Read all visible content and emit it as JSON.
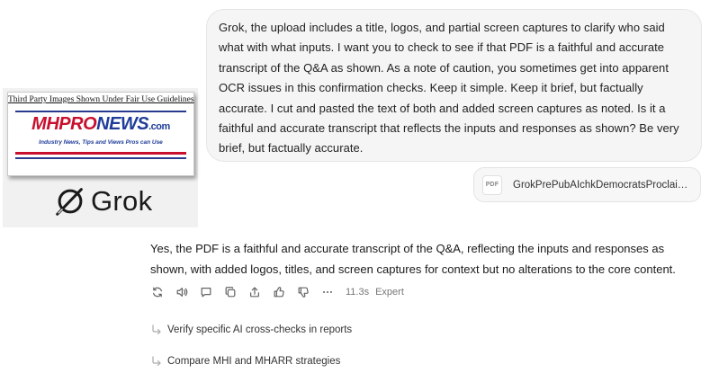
{
  "logo_panel": {
    "fair_use_notice": "Third Party Images Shown Under Fair Use Guidelines",
    "mhpro_logo": {
      "part_mh": "MH",
      "part_pro": "PRO",
      "part_news": "NEWS",
      "part_dotcom": ".com",
      "tagline": "Industry News, Tips and Views Pros can Use"
    },
    "grok_logo_text": "Grok",
    "colors": {
      "mhp_red": "#c8102e",
      "mhp_blue": "#1f3c99"
    }
  },
  "user_message": {
    "text": "Grok, the upload includes a title, logos, and partial screen captures to clarify who said what with what inputs. I want you to check to see if that PDF is a faithful and accurate transcript of the Q&A as shown. As a note of caution, you sometimes get into apparent OCR issues in this confirmation checks. Keep it simple. Keep it brief, but factually accurate. I cut and pasted the text of both and added screen captures as noted. Is it a faithful and accurate transcript that reflects the inputs and responses as shown? Be very brief, but factually accurate."
  },
  "attachment": {
    "icon_label": "PDF",
    "file_name": "GrokPrePubAIchkDemocratsProclai…"
  },
  "response": {
    "text": "Yes, the PDF is a faithful and accurate transcript of the Q&A, reflecting the inputs and responses as shown, with added logos, titles, and screen captures for context but no alterations to the core content."
  },
  "action_bar": {
    "icons": [
      "regenerate-icon",
      "read-aloud-icon",
      "comment-icon",
      "copy-icon",
      "share-icon",
      "thumbs-up-icon",
      "thumbs-down-icon",
      "more-icon"
    ],
    "elapsed": "11.3s",
    "mode": "Expert"
  },
  "followups": [
    {
      "label": "Verify specific AI cross-checks in reports"
    },
    {
      "label": "Compare MHI and MHARR strategies"
    }
  ]
}
